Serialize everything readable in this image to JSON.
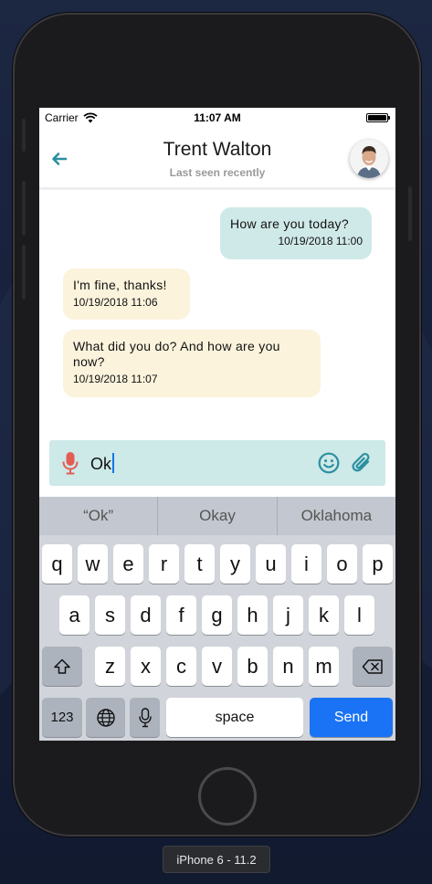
{
  "device_label": "iPhone 6 - 11.2",
  "status_bar": {
    "carrier": "Carrier",
    "time": "11:07 AM"
  },
  "header": {
    "title": "Trent Walton",
    "subtitle": "Last seen recently"
  },
  "messages": [
    {
      "direction": "outgoing",
      "text": "How are you today?",
      "timestamp": "10/19/2018 11:00"
    },
    {
      "direction": "incoming",
      "text": "I'm fine, thanks!",
      "timestamp": "10/19/2018 11:06"
    },
    {
      "direction": "incoming",
      "text": "What did you do? And how are you now?",
      "timestamp": "10/19/2018 11:07"
    }
  ],
  "composer": {
    "value": "Ok"
  },
  "keyboard": {
    "suggestions": [
      "“Ok”",
      "Okay",
      "Oklahoma"
    ],
    "row1": [
      "q",
      "w",
      "e",
      "r",
      "t",
      "y",
      "u",
      "i",
      "o",
      "p"
    ],
    "row2": [
      "a",
      "s",
      "d",
      "f",
      "g",
      "h",
      "j",
      "k",
      "l"
    ],
    "row3": [
      "z",
      "x",
      "c",
      "v",
      "b",
      "n",
      "m"
    ],
    "numbers_label": "123",
    "space_label": "space",
    "send_label": "Send"
  },
  "colors": {
    "outgoing_bubble": "#cfe9e8",
    "incoming_bubble": "#fbf3dc",
    "accent": "#2a8fa0",
    "send_key": "#1a73f5",
    "mic": "#e35d55"
  }
}
